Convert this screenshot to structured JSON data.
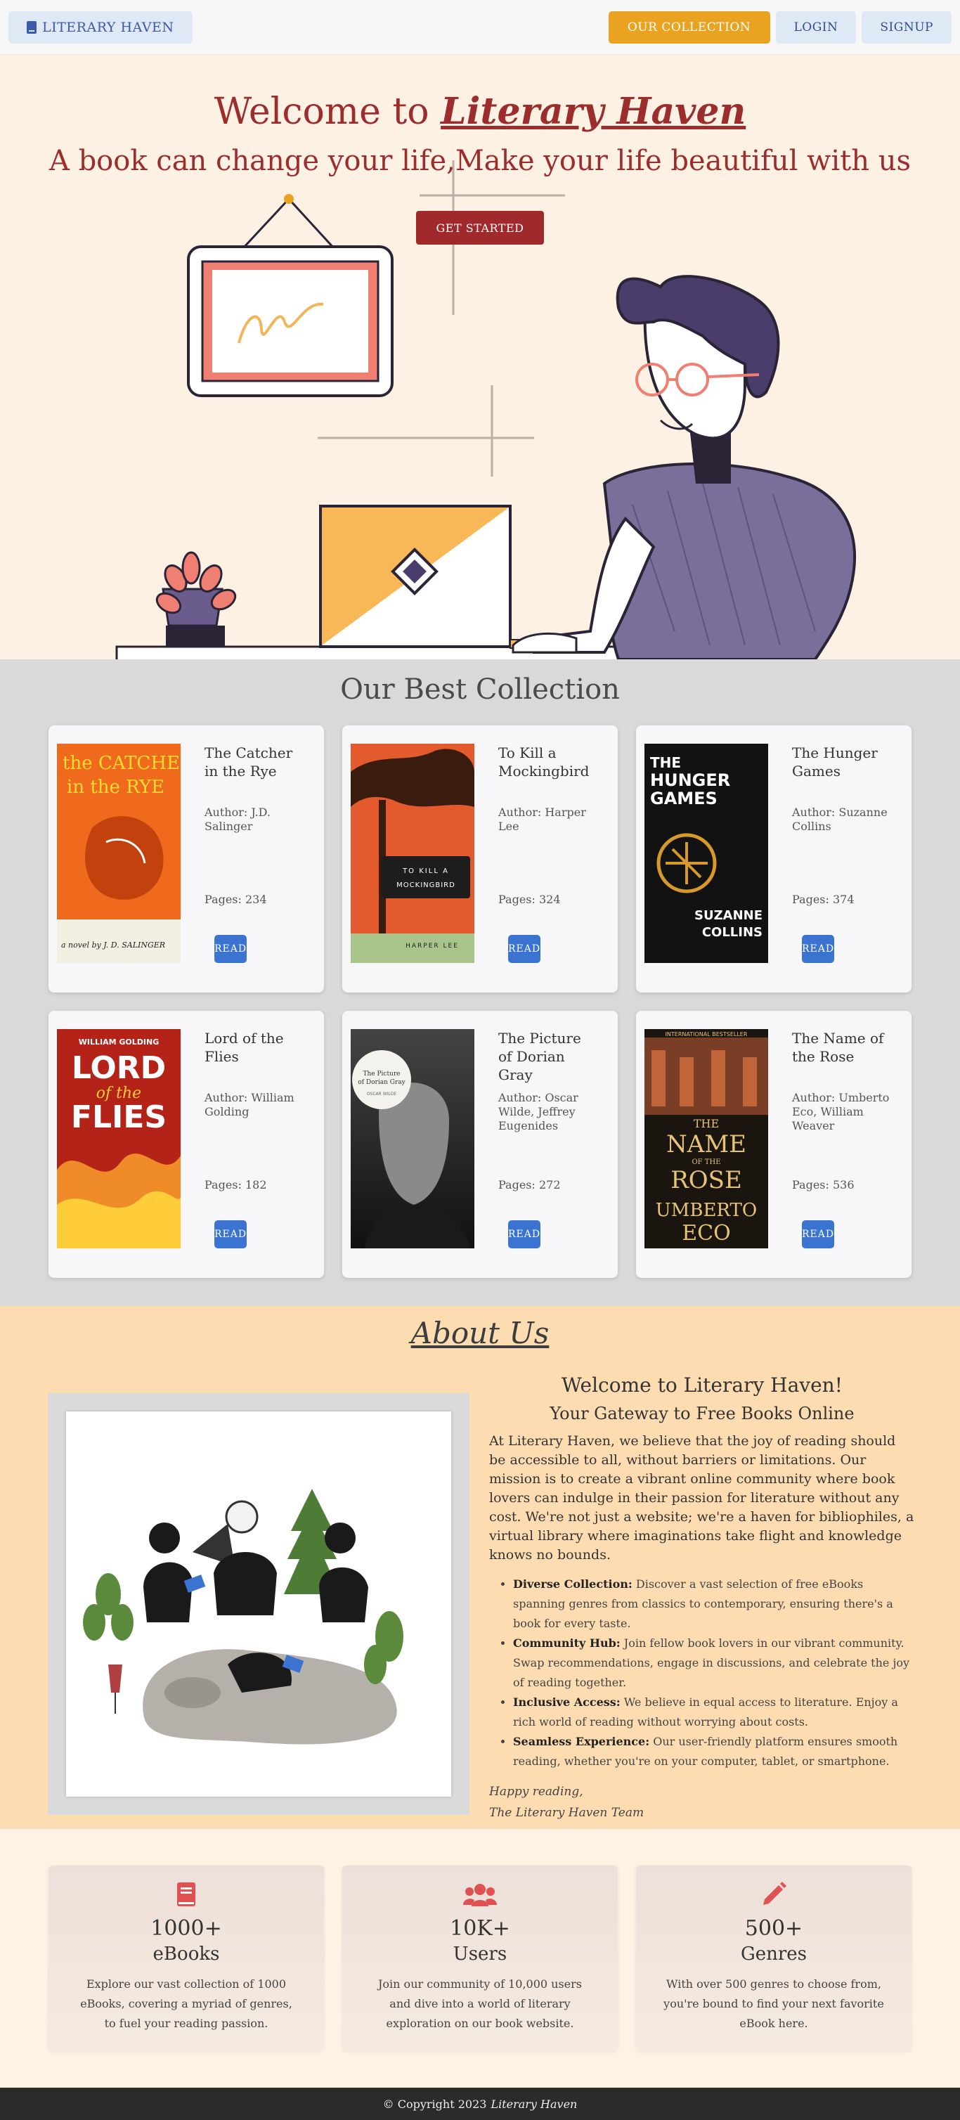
{
  "nav": {
    "brand": "LITERARY HAVEN",
    "collection": "OUR COLLECTION",
    "login": "LOGIN",
    "signup": "SIGNUP"
  },
  "hero": {
    "welcome": "Welcome to",
    "name": "Literary Haven",
    "tagline": "A book can change your life,Make your life beautiful with us",
    "cta": "GET STARTED"
  },
  "collection": {
    "title": "Our Best Collection",
    "read_label": "READ",
    "books": [
      {
        "title": "The Catcher in the Rye",
        "author": "Author: J.D. Salinger",
        "pages": "Pages: 234",
        "cover_text": [
          "the CATCHER",
          "in the RYE",
          "a novel by J. D. SALINGER"
        ]
      },
      {
        "title": "To Kill a Mockingbird",
        "author": "Author: Harper Lee",
        "pages": "Pages: 324",
        "cover_text": [
          "TO KILL A",
          "MOCKINGBIRD",
          "HARPER LEE"
        ]
      },
      {
        "title": "The Hunger Games",
        "author": "Author: Suzanne Collins",
        "pages": "Pages: 374",
        "cover_text": [
          "THE",
          "HUNGER",
          "GAMES",
          "SUZANNE",
          "COLLINS"
        ]
      },
      {
        "title": "Lord of the Flies",
        "author": "Author: William Golding",
        "pages": "Pages: 182",
        "cover_text": [
          "WILLIAM GOLDING",
          "LORD",
          "of the",
          "FLIES"
        ]
      },
      {
        "title": "The Picture of Dorian Gray",
        "author": "Author: Oscar Wilde, Jeffrey Eugenides",
        "pages": "Pages: 272",
        "cover_text": [
          "The Picture",
          "of Dorian Gray",
          "OSCAR WILDE"
        ]
      },
      {
        "title": "The Name of the Rose",
        "author": "Author: Umberto Eco, William Weaver",
        "pages": "Pages: 536",
        "cover_text": [
          "INTERNATIONAL BESTSELLER",
          "THE",
          "NAME",
          "OF THE",
          "ROSE",
          "UMBERTO",
          "ECO"
        ]
      }
    ]
  },
  "about": {
    "title": "About Us",
    "welcome": "Welcome to Literary Haven!",
    "gateway": "Your Gateway to Free Books Online",
    "body": "At Literary Haven, we believe that the joy of reading should be accessible to all, without barriers or limitations. Our mission is to create a vibrant online community where book lovers can indulge in their passion for literature without any cost. We're not just a website; we're a haven for bibliophiles, a virtual library where imaginations take flight and knowledge knows no bounds.",
    "points": [
      {
        "head": "Diverse Collection:",
        "text": " Discover a vast selection of free eBooks spanning genres from classics to contemporary, ensuring there's a book for every taste."
      },
      {
        "head": "Community Hub:",
        "text": " Join fellow book lovers in our vibrant community. Swap recommendations, engage in discussions, and celebrate the joy of reading together."
      },
      {
        "head": "Inclusive Access:",
        "text": " We believe in equal access to literature. Enjoy a rich world of reading without worrying about costs."
      },
      {
        "head": "Seamless Experience:",
        "text": " Our user-friendly platform ensures smooth reading, whether you're on your computer, tablet, or smartphone."
      }
    ],
    "sign1": "Happy reading,",
    "sign2": "The Literary Haven Team"
  },
  "stats": [
    {
      "num": "1000+",
      "label": "eBooks",
      "desc": "Explore our vast collection of 1000 eBooks, covering a myriad of genres, to fuel your reading passion.",
      "icon": "book-icon"
    },
    {
      "num": "10K+",
      "label": "Users",
      "desc": "Join our community of 10,000 users and dive into a world of literary exploration on our book website.",
      "icon": "users-icon"
    },
    {
      "num": "500+",
      "label": "Genres",
      "desc": "With over 500 genres to choose from, you're bound to find your next favorite eBook here.",
      "icon": "pencil-icon"
    }
  ],
  "footer": {
    "copyright": "© Copyright 2023",
    "name": "Literary Haven"
  },
  "colors": {
    "accent": "#e9a321",
    "brand_red": "#9c2d2d",
    "read_blue": "#3b73d1",
    "stat_icon": "#e05252"
  }
}
